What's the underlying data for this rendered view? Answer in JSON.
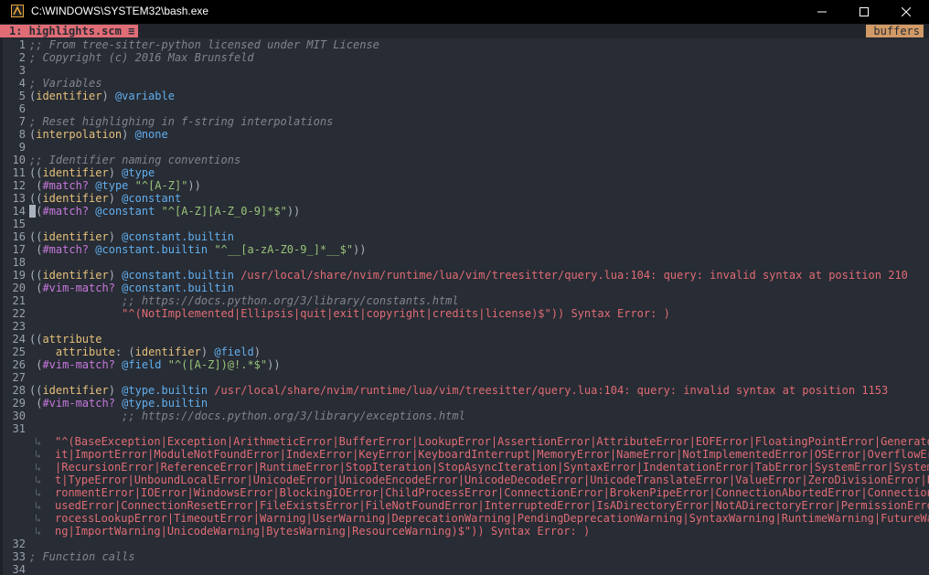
{
  "window": {
    "title": "C:\\WINDOWS\\SYSTEM32\\bash.exe",
    "icon": "terminal-app-icon",
    "controls": [
      "minimize-icon",
      "maximize-icon",
      "close-icon"
    ]
  },
  "tabline": {
    "active_tab": "1: highlights.scm",
    "tab_icon": "≡",
    "buffers_label": "buffers"
  },
  "lines": [
    {
      "n": "1",
      "segs": [
        {
          "t": ";; From tree-sitter-python licensed under MIT License",
          "c": "com"
        }
      ]
    },
    {
      "n": "2",
      "segs": [
        {
          "t": "; Copyright (c) 2016 Max Brunsfeld",
          "c": "com"
        }
      ]
    },
    {
      "n": "3",
      "segs": []
    },
    {
      "n": "4",
      "segs": [
        {
          "t": "; Variables",
          "c": "com"
        }
      ]
    },
    {
      "n": "5",
      "segs": [
        {
          "t": "(",
          "c": "pn"
        },
        {
          "t": "identifier",
          "c": "id"
        },
        {
          "t": ") ",
          "c": "pn"
        },
        {
          "t": "@variable",
          "c": "cap"
        }
      ]
    },
    {
      "n": "6",
      "segs": []
    },
    {
      "n": "7",
      "segs": [
        {
          "t": "; Reset highlighing in f-string interpolations",
          "c": "com"
        }
      ]
    },
    {
      "n": "8",
      "segs": [
        {
          "t": "(",
          "c": "pn"
        },
        {
          "t": "interpolation",
          "c": "id"
        },
        {
          "t": ") ",
          "c": "pn"
        },
        {
          "t": "@none",
          "c": "cap"
        }
      ]
    },
    {
      "n": "9",
      "segs": []
    },
    {
      "n": "10",
      "segs": [
        {
          "t": ";; Identifier naming conventions",
          "c": "com"
        }
      ]
    },
    {
      "n": "11",
      "segs": [
        {
          "t": "((",
          "c": "pn"
        },
        {
          "t": "identifier",
          "c": "id"
        },
        {
          "t": ") ",
          "c": "pn"
        },
        {
          "t": "@type",
          "c": "cap"
        }
      ]
    },
    {
      "n": "12",
      "segs": [
        {
          "t": " (",
          "c": "pn"
        },
        {
          "t": "#match?",
          "c": "kw"
        },
        {
          "t": " ",
          "c": "pn"
        },
        {
          "t": "@type",
          "c": "cap"
        },
        {
          "t": " ",
          "c": "pn"
        },
        {
          "t": "\"^[A-Z]\"",
          "c": "str"
        },
        {
          "t": "))",
          "c": "pn"
        }
      ]
    },
    {
      "n": "13",
      "segs": [
        {
          "t": "((",
          "c": "pn"
        },
        {
          "t": "identifier",
          "c": "id"
        },
        {
          "t": ") ",
          "c": "pn"
        },
        {
          "t": "@constant",
          "c": "cap"
        }
      ]
    },
    {
      "n": "14",
      "segs": [
        {
          "t": " ",
          "c": "cursor"
        },
        {
          "t": "(",
          "c": "pn"
        },
        {
          "t": "#match?",
          "c": "kw"
        },
        {
          "t": " ",
          "c": "pn"
        },
        {
          "t": "@constant",
          "c": "cap"
        },
        {
          "t": " ",
          "c": "pn"
        },
        {
          "t": "\"^[A-Z][A-Z_0-9]*$\"",
          "c": "str"
        },
        {
          "t": "))",
          "c": "pn"
        }
      ]
    },
    {
      "n": "15",
      "segs": []
    },
    {
      "n": "16",
      "segs": [
        {
          "t": "((",
          "c": "pn"
        },
        {
          "t": "identifier",
          "c": "id"
        },
        {
          "t": ") ",
          "c": "pn"
        },
        {
          "t": "@constant.builtin",
          "c": "cap"
        }
      ]
    },
    {
      "n": "17",
      "segs": [
        {
          "t": " (",
          "c": "pn"
        },
        {
          "t": "#match?",
          "c": "kw"
        },
        {
          "t": " ",
          "c": "pn"
        },
        {
          "t": "@constant.builtin",
          "c": "cap"
        },
        {
          "t": " ",
          "c": "pn"
        },
        {
          "t": "\"^__[a-zA-Z0-9_]*__$\"",
          "c": "str"
        },
        {
          "t": "))",
          "c": "pn"
        }
      ]
    },
    {
      "n": "18",
      "segs": []
    },
    {
      "n": "19",
      "segs": [
        {
          "t": "((",
          "c": "pn"
        },
        {
          "t": "identifier",
          "c": "id"
        },
        {
          "t": ") ",
          "c": "pn"
        },
        {
          "t": "@constant.builtin",
          "c": "cap"
        },
        {
          "t": " /usr/local/share/nvim/runtime/lua/vim/treesitter/query.lua:104: query: invalid syntax at position 210",
          "c": "err"
        }
      ]
    },
    {
      "n": "20",
      "segs": [
        {
          "t": " (",
          "c": "pn"
        },
        {
          "t": "#vim-match?",
          "c": "kw"
        },
        {
          "t": " ",
          "c": "pn"
        },
        {
          "t": "@constant.builtin",
          "c": "cap"
        }
      ]
    },
    {
      "n": "21",
      "segs": [
        {
          "t": "              ;; https://docs.python.org/3/library/constants.html",
          "c": "com"
        }
      ]
    },
    {
      "n": "22",
      "segs": [
        {
          "t": "              ",
          "c": "pn"
        },
        {
          "t": "\"^(NotImplemented|Ellipsis|quit|exit|copyright|credits|license)$\"",
          "c": "err"
        },
        {
          "t": ")) Syntax Error: )",
          "c": "err"
        }
      ]
    },
    {
      "n": "23",
      "segs": []
    },
    {
      "n": "24",
      "segs": [
        {
          "t": "((",
          "c": "pn"
        },
        {
          "t": "attribute",
          "c": "id"
        }
      ]
    },
    {
      "n": "25",
      "segs": [
        {
          "t": "    ",
          "c": "pn"
        },
        {
          "t": "attribute",
          "c": "id"
        },
        {
          "t": ": (",
          "c": "pn"
        },
        {
          "t": "identifier",
          "c": "id"
        },
        {
          "t": ") ",
          "c": "pn"
        },
        {
          "t": "@field",
          "c": "cap"
        },
        {
          "t": ")",
          "c": "pn"
        }
      ]
    },
    {
      "n": "26",
      "segs": [
        {
          "t": " (",
          "c": "pn"
        },
        {
          "t": "#vim-match?",
          "c": "kw"
        },
        {
          "t": " ",
          "c": "pn"
        },
        {
          "t": "@field",
          "c": "cap"
        },
        {
          "t": " ",
          "c": "pn"
        },
        {
          "t": "\"^([A-Z])@!.*$\"",
          "c": "str"
        },
        {
          "t": "))",
          "c": "pn"
        }
      ]
    },
    {
      "n": "27",
      "segs": []
    },
    {
      "n": "28",
      "segs": [
        {
          "t": "((",
          "c": "pn"
        },
        {
          "t": "identifier",
          "c": "id"
        },
        {
          "t": ") ",
          "c": "pn"
        },
        {
          "t": "@type.builtin",
          "c": "cap"
        },
        {
          "t": " /usr/local/share/nvim/runtime/lua/vim/treesitter/query.lua:104: query: invalid syntax at position 1153",
          "c": "err"
        }
      ]
    },
    {
      "n": "29",
      "segs": [
        {
          "t": " (",
          "c": "pn"
        },
        {
          "t": "#vim-match?",
          "c": "kw"
        },
        {
          "t": " ",
          "c": "pn"
        },
        {
          "t": "@type.builtin",
          "c": "cap"
        }
      ]
    },
    {
      "n": "30",
      "segs": [
        {
          "t": "              ;; https://docs.python.org/3/library/exceptions.html",
          "c": "com"
        }
      ]
    },
    {
      "n": "31",
      "segs": []
    }
  ],
  "wrapped_line": {
    "mark": "↳",
    "rows": [
      "\"^(BaseException|Exception|ArithmeticError|BufferError|LookupError|AssertionError|AttributeError|EOFError|FloatingPointError|GeneratorEx",
      "it|ImportError|ModuleNotFoundError|IndexError|KeyError|KeyboardInterrupt|MemoryError|NameError|NotImplementedError|OSError|OverflowError",
      "|RecursionError|ReferenceError|RuntimeError|StopIteration|StopAsyncIteration|SyntaxError|IndentationError|TabError|SystemError|SystemExi",
      "t|TypeError|UnboundLocalError|UnicodeError|UnicodeEncodeError|UnicodeDecodeError|UnicodeTranslateError|ValueError|ZeroDivisionError|Envi",
      "ronmentError|IOError|WindowsError|BlockingIOError|ChildProcessError|ConnectionError|BrokenPipeError|ConnectionAbortedError|ConnectionRef",
      "usedError|ConnectionResetError|FileExistsError|FileNotFoundError|InterruptedError|IsADirectoryError|NotADirectoryError|PermissionError|P",
      "rocessLookupError|TimeoutError|Warning|UserWarning|DeprecationWarning|PendingDeprecationWarning|SyntaxWarning|RuntimeWarning|FutureWarni",
      "ng|ImportWarning|UnicodeWarning|BytesWarning|ResourceWarning)$\")) Syntax Error: )"
    ]
  },
  "tail_lines": [
    {
      "n": "32",
      "segs": []
    },
    {
      "n": "33",
      "segs": [
        {
          "t": "; Function calls",
          "c": "com"
        }
      ]
    },
    {
      "n": "34",
      "segs": []
    }
  ],
  "colors": {
    "background": "#282c34",
    "comment": "#7f848e",
    "identifier": "#e5c07b",
    "capture": "#61afef",
    "predicate": "#c678dd",
    "string": "#98c379",
    "error": "#e06c75",
    "tab_active": "#e06c75",
    "buffers_tag": "#d19a66"
  }
}
